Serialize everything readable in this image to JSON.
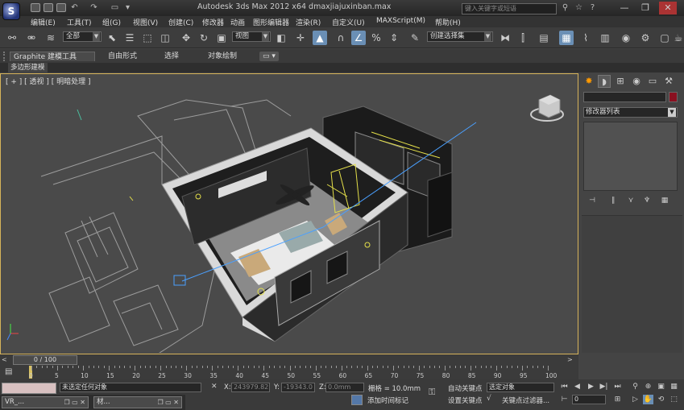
{
  "title": "Autodesk 3ds Max  2012 x64      dmaxjiajuxinban.max",
  "search_placeholder": "键入关键字或短语",
  "menu": [
    "编辑(E)",
    "工具(T)",
    "组(G)",
    "视图(V)",
    "创建(C)",
    "修改器",
    "动画",
    "图形编辑器",
    "渲染(R)",
    "自定义(U)",
    "MAXScript(M)",
    "帮助(H)"
  ],
  "toolbar": {
    "selection_filter": "全部",
    "ref_coord": "视图",
    "named_selection": "创建选择集"
  },
  "ribbon": {
    "tabs": [
      "Graphite 建模工具",
      "自由形式",
      "选择",
      "对象绘制"
    ],
    "subtab": "多边形建模"
  },
  "viewport": {
    "label_plus": "[ + ]",
    "label_view": "[ 透视 ]",
    "label_shading": "[ 明暗处理 ]"
  },
  "command_panel": {
    "modifier_list": "修改器列表"
  },
  "timeline": {
    "frame_display": "0 / 100",
    "ticks": [
      "0",
      "5",
      "10",
      "15",
      "20",
      "25",
      "30",
      "35",
      "40",
      "45",
      "50",
      "55",
      "60",
      "65",
      "70",
      "75",
      "80",
      "85",
      "90",
      "95",
      "100"
    ]
  },
  "status": {
    "selection_info": "未选定任何对象",
    "x_label": "X:",
    "x_value": "243979.82",
    "y_label": "Y:",
    "y_value": "-19343.0",
    "z_label": "Z:",
    "z_value": "0.0mm",
    "grid": "栅格 = 10.0mm",
    "auto_key": "自动关键点",
    "set_key": "设置关键点",
    "selected_object": "选定对象",
    "key_filters": "关键点过滤器...",
    "add_time_tag": "添加时间标记",
    "frame_field": "0"
  },
  "taskbar": [
    "VR_...",
    "材..."
  ]
}
